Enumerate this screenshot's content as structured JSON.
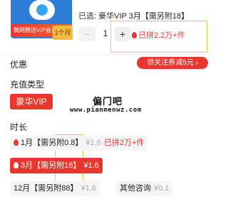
{
  "product": {
    "thumb_banner_text": "微网赠送VIP会员",
    "thumb_badge": "1个月",
    "selected_prefix": "已选:",
    "selected_value": "豪华VIP 3月【需另附18】",
    "quantity": "1",
    "minus_symbol": "−",
    "plus_symbol": "+",
    "joined_stat": "已拼2.2万+件"
  },
  "discount": {
    "label": "优惠",
    "coupon_text": "领关注券减5元 ›"
  },
  "recharge": {
    "label": "充值类型",
    "option_label": "豪华VIP"
  },
  "watermark": {
    "title": "偏门吧",
    "url": "www.pianmenwz.com"
  },
  "duration": {
    "label": "时长",
    "options": [
      {
        "label": "1月【需另附0.8】",
        "price": "¥1.6",
        "stat": "已拼2万+件",
        "hot": true,
        "selected": false
      },
      {
        "label": "3月【需另附18】",
        "price": "¥1.6",
        "stat": "",
        "hot": true,
        "selected": true
      },
      {
        "label": "12月【需另附88】",
        "price": "¥1.6",
        "stat": "",
        "hot": false,
        "selected": false
      },
      {
        "label": "其他咨询",
        "price": "¥0.1",
        "stat": "",
        "hot": false,
        "selected": false
      }
    ]
  },
  "colors": {
    "accent": "#e8372e",
    "highlight_box": "#f2c54b",
    "thumb_blue": "#2f7bd8"
  }
}
